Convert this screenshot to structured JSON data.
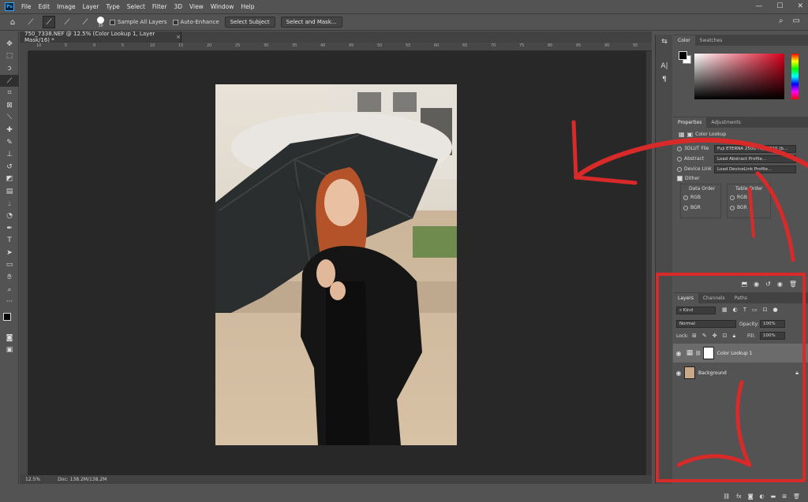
{
  "menu": [
    "File",
    "Edit",
    "Image",
    "Layer",
    "Type",
    "Select",
    "Filter",
    "3D",
    "View",
    "Window",
    "Help"
  ],
  "app_logo": "Ps",
  "window_controls": [
    "—",
    "☐",
    "✕"
  ],
  "options": {
    "brush_size": "30",
    "sample_all_layers": "Sample All Layers",
    "auto_enhance": "Auto-Enhance",
    "select_subject": "Select Subject",
    "select_and_mask": "Select and Mask..."
  },
  "doc_tab": {
    "title": "750_7338.NEF @ 12.5% (Color Lookup 1, Layer Mask/16) *",
    "close": "×"
  },
  "ruler_numbers": [
    "10",
    "5",
    "0",
    "5",
    "10",
    "15",
    "20",
    "25",
    "30",
    "35",
    "40",
    "45",
    "50",
    "55",
    "60",
    "65",
    "70",
    "75",
    "80",
    "85",
    "90",
    "95"
  ],
  "status": {
    "zoom": "12.5%",
    "doc": "Doc: 138.2M/138.2M"
  },
  "color_panel": {
    "tabs": [
      "Color",
      "Swatches"
    ],
    "accent": "#d8001c"
  },
  "properties": {
    "tabs": [
      "Properties",
      "Adjustments"
    ],
    "title": "Color Lookup",
    "options": [
      {
        "label": "3DLUT File",
        "value": "Fuji ETERNA 250D Fuji 3510 (b..."
      },
      {
        "label": "Abstract",
        "value": "Load Abstract Profile..."
      },
      {
        "label": "Device Link",
        "value": "Load DeviceLink Profile..."
      }
    ],
    "dither": "Dither",
    "data_order": {
      "label": "Data Order",
      "options": [
        "RGB",
        "BGR"
      ]
    },
    "table_order": {
      "label": "Table Order",
      "options": [
        "RGB",
        "BGR"
      ]
    }
  },
  "layers_panel": {
    "tabs": [
      "Layers",
      "Channels",
      "Paths"
    ],
    "kind": "Kind",
    "blend": "Normal",
    "opacity_label": "Opacity:",
    "opacity": "100%",
    "lock_label": "Lock:",
    "fill_label": "Fill:",
    "fill": "100%",
    "layers": [
      {
        "name": "Color Lookup 1",
        "selected": true
      },
      {
        "name": "Background",
        "selected": false
      }
    ],
    "footer_icons": [
      "link-icon",
      "fx-icon",
      "mask-icon",
      "adjustment-icon",
      "folder-icon",
      "new-layer-icon",
      "trash-icon"
    ]
  },
  "annotation_color": "#d92a2a"
}
